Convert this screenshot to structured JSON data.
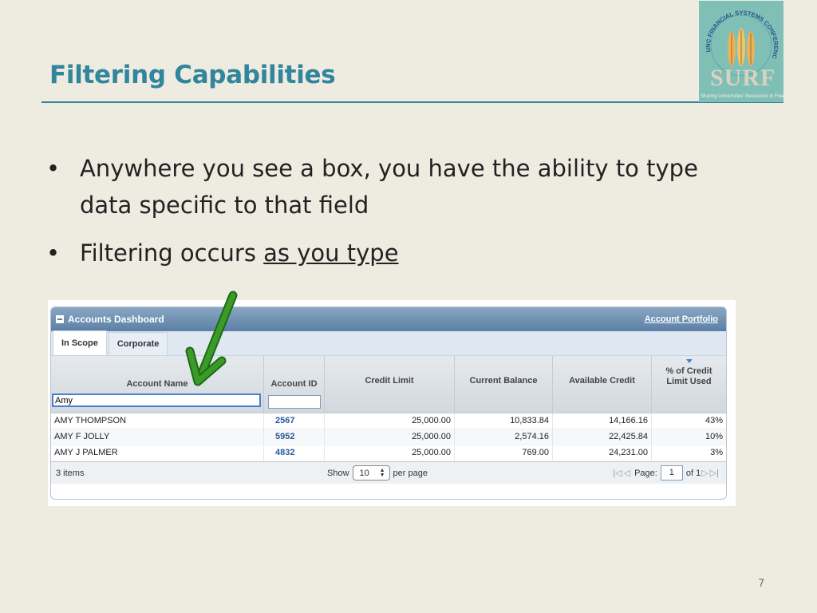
{
  "slide": {
    "title": "Filtering Capabilities",
    "page_number": "7",
    "bullets": [
      {
        "text": "Anywhere you see a box, you have the ability to type data specific to that field"
      },
      {
        "text": "Filtering occurs ",
        "underlined": "as you type"
      }
    ],
    "logo": {
      "ring_text": "UNC FINANCIAL SYSTEMS CONFERENCE",
      "word": "SURF",
      "subtitle": "Sharing Universities' Resources in Finance"
    }
  },
  "dashboard": {
    "title": "Accounts Dashboard",
    "link": "Account Portfolio",
    "tabs": [
      {
        "label": "In Scope",
        "active": true
      },
      {
        "label": "Corporate",
        "active": false
      }
    ],
    "columns": {
      "account_name": "Account Name",
      "account_id": "Account ID",
      "credit_limit": "Credit Limit",
      "current_balance": "Current Balance",
      "available_credit": "Available Credit",
      "pct_line1": "% of Credit",
      "pct_line2": "Limit Used"
    },
    "filters": {
      "account_name": "Amy",
      "account_id": ""
    },
    "rows": [
      {
        "name": "AMY THOMPSON",
        "id": "2567",
        "credit_limit": "25,000.00",
        "current_balance": "10,833.84",
        "available_credit": "14,166.16",
        "pct": "43%"
      },
      {
        "name": "AMY F JOLLY",
        "id": "5952",
        "credit_limit": "25,000.00",
        "current_balance": "2,574.16",
        "available_credit": "22,425.84",
        "pct": "10%"
      },
      {
        "name": "AMY J PALMER",
        "id": "4832",
        "credit_limit": "25,000.00",
        "current_balance": "769.00",
        "available_credit": "24,231.00",
        "pct": "3%"
      }
    ],
    "pager": {
      "count": "3 items",
      "show_label": "Show",
      "per_page_value": "10",
      "per_page_label": "per page",
      "page_label": "Page:",
      "page_value": "1",
      "of_label": "of 1"
    },
    "accent_color": "#31859c",
    "arrow_color": "#3a9a2a"
  }
}
